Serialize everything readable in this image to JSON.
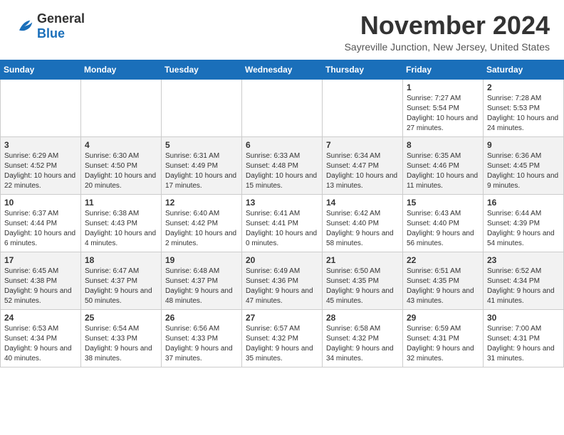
{
  "header": {
    "logo_general": "General",
    "logo_blue": "Blue",
    "month_title": "November 2024",
    "subtitle": "Sayreville Junction, New Jersey, United States"
  },
  "calendar": {
    "days_of_week": [
      "Sunday",
      "Monday",
      "Tuesday",
      "Wednesday",
      "Thursday",
      "Friday",
      "Saturday"
    ],
    "weeks": [
      [
        {
          "day": "",
          "info": ""
        },
        {
          "day": "",
          "info": ""
        },
        {
          "day": "",
          "info": ""
        },
        {
          "day": "",
          "info": ""
        },
        {
          "day": "",
          "info": ""
        },
        {
          "day": "1",
          "info": "Sunrise: 7:27 AM\nSunset: 5:54 PM\nDaylight: 10 hours and 27 minutes."
        },
        {
          "day": "2",
          "info": "Sunrise: 7:28 AM\nSunset: 5:53 PM\nDaylight: 10 hours and 24 minutes."
        }
      ],
      [
        {
          "day": "3",
          "info": "Sunrise: 6:29 AM\nSunset: 4:52 PM\nDaylight: 10 hours and 22 minutes."
        },
        {
          "day": "4",
          "info": "Sunrise: 6:30 AM\nSunset: 4:50 PM\nDaylight: 10 hours and 20 minutes."
        },
        {
          "day": "5",
          "info": "Sunrise: 6:31 AM\nSunset: 4:49 PM\nDaylight: 10 hours and 17 minutes."
        },
        {
          "day": "6",
          "info": "Sunrise: 6:33 AM\nSunset: 4:48 PM\nDaylight: 10 hours and 15 minutes."
        },
        {
          "day": "7",
          "info": "Sunrise: 6:34 AM\nSunset: 4:47 PM\nDaylight: 10 hours and 13 minutes."
        },
        {
          "day": "8",
          "info": "Sunrise: 6:35 AM\nSunset: 4:46 PM\nDaylight: 10 hours and 11 minutes."
        },
        {
          "day": "9",
          "info": "Sunrise: 6:36 AM\nSunset: 4:45 PM\nDaylight: 10 hours and 9 minutes."
        }
      ],
      [
        {
          "day": "10",
          "info": "Sunrise: 6:37 AM\nSunset: 4:44 PM\nDaylight: 10 hours and 6 minutes."
        },
        {
          "day": "11",
          "info": "Sunrise: 6:38 AM\nSunset: 4:43 PM\nDaylight: 10 hours and 4 minutes."
        },
        {
          "day": "12",
          "info": "Sunrise: 6:40 AM\nSunset: 4:42 PM\nDaylight: 10 hours and 2 minutes."
        },
        {
          "day": "13",
          "info": "Sunrise: 6:41 AM\nSunset: 4:41 PM\nDaylight: 10 hours and 0 minutes."
        },
        {
          "day": "14",
          "info": "Sunrise: 6:42 AM\nSunset: 4:40 PM\nDaylight: 9 hours and 58 minutes."
        },
        {
          "day": "15",
          "info": "Sunrise: 6:43 AM\nSunset: 4:40 PM\nDaylight: 9 hours and 56 minutes."
        },
        {
          "day": "16",
          "info": "Sunrise: 6:44 AM\nSunset: 4:39 PM\nDaylight: 9 hours and 54 minutes."
        }
      ],
      [
        {
          "day": "17",
          "info": "Sunrise: 6:45 AM\nSunset: 4:38 PM\nDaylight: 9 hours and 52 minutes."
        },
        {
          "day": "18",
          "info": "Sunrise: 6:47 AM\nSunset: 4:37 PM\nDaylight: 9 hours and 50 minutes."
        },
        {
          "day": "19",
          "info": "Sunrise: 6:48 AM\nSunset: 4:37 PM\nDaylight: 9 hours and 48 minutes."
        },
        {
          "day": "20",
          "info": "Sunrise: 6:49 AM\nSunset: 4:36 PM\nDaylight: 9 hours and 47 minutes."
        },
        {
          "day": "21",
          "info": "Sunrise: 6:50 AM\nSunset: 4:35 PM\nDaylight: 9 hours and 45 minutes."
        },
        {
          "day": "22",
          "info": "Sunrise: 6:51 AM\nSunset: 4:35 PM\nDaylight: 9 hours and 43 minutes."
        },
        {
          "day": "23",
          "info": "Sunrise: 6:52 AM\nSunset: 4:34 PM\nDaylight: 9 hours and 41 minutes."
        }
      ],
      [
        {
          "day": "24",
          "info": "Sunrise: 6:53 AM\nSunset: 4:34 PM\nDaylight: 9 hours and 40 minutes."
        },
        {
          "day": "25",
          "info": "Sunrise: 6:54 AM\nSunset: 4:33 PM\nDaylight: 9 hours and 38 minutes."
        },
        {
          "day": "26",
          "info": "Sunrise: 6:56 AM\nSunset: 4:33 PM\nDaylight: 9 hours and 37 minutes."
        },
        {
          "day": "27",
          "info": "Sunrise: 6:57 AM\nSunset: 4:32 PM\nDaylight: 9 hours and 35 minutes."
        },
        {
          "day": "28",
          "info": "Sunrise: 6:58 AM\nSunset: 4:32 PM\nDaylight: 9 hours and 34 minutes."
        },
        {
          "day": "29",
          "info": "Sunrise: 6:59 AM\nSunset: 4:31 PM\nDaylight: 9 hours and 32 minutes."
        },
        {
          "day": "30",
          "info": "Sunrise: 7:00 AM\nSunset: 4:31 PM\nDaylight: 9 hours and 31 minutes."
        }
      ]
    ]
  }
}
